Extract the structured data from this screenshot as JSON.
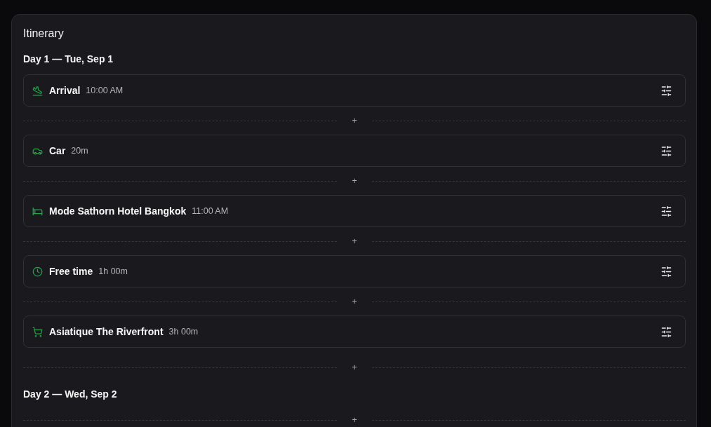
{
  "title": "Itinerary",
  "days": [
    {
      "label": "Day 1 — Tue, Sep 1",
      "rows": [
        {
          "kind": "arrival",
          "title": "Arrival",
          "detail": "10:00 AM"
        },
        {
          "kind": "insert",
          "label": "+"
        },
        {
          "kind": "car",
          "title": "Car",
          "detail": "20m"
        },
        {
          "kind": "insert",
          "label": "+"
        },
        {
          "kind": "hotel",
          "title": "Mode Sathorn Hotel Bangkok",
          "detail": "11:00 AM"
        },
        {
          "kind": "insert",
          "label": "+"
        },
        {
          "kind": "free",
          "title": "Free time",
          "detail": "1h 00m"
        },
        {
          "kind": "insert",
          "label": "+"
        },
        {
          "kind": "shopping",
          "title": "Asiatique The Riverfront",
          "detail": "3h 00m"
        },
        {
          "kind": "insert",
          "label": "+"
        }
      ]
    },
    {
      "label": "Day 2 — Wed, Sep 2",
      "rows": [
        {
          "kind": "insert",
          "label": "+"
        }
      ]
    }
  ]
}
